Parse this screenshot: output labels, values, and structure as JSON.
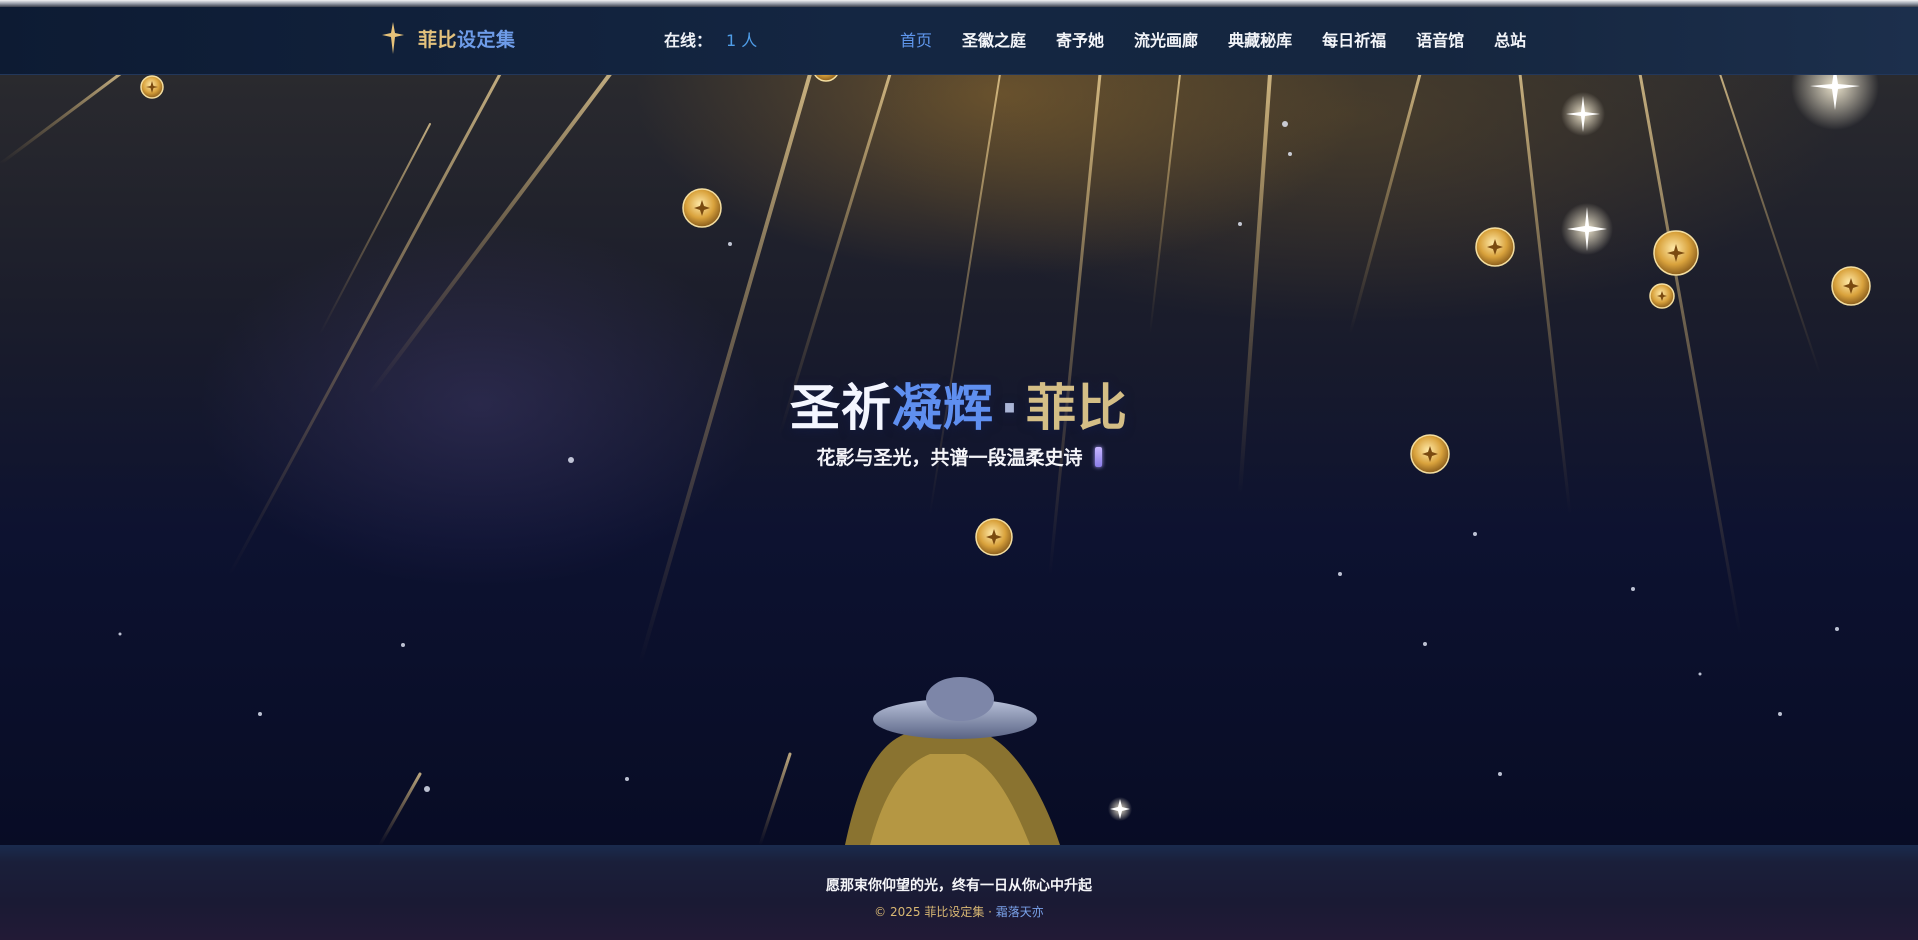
{
  "header": {
    "logo_icon": "sparkle-icon",
    "brand_part1": "菲比",
    "brand_part2": "设定集",
    "online_label": "在线：",
    "online_count": "1 人",
    "nav": [
      {
        "label": "首页",
        "active": true
      },
      {
        "label": "圣徽之庭"
      },
      {
        "label": "寄予她"
      },
      {
        "label": "流光画廊"
      },
      {
        "label": "典藏秘库"
      },
      {
        "label": "每日祈福"
      },
      {
        "label": "语音馆"
      },
      {
        "label": "总站"
      }
    ]
  },
  "hero": {
    "title_part1": "圣祈",
    "title_part2": "凝辉",
    "title_sep": "·",
    "title_part3": "菲比",
    "subtitle": "花影与圣光，共谱一段温柔史诗"
  },
  "footer": {
    "line1": "愿那束你仰望的光，终有一日从你心中升起",
    "copyright": "© 2025 菲比设定集 · ",
    "author": "霜落天亦"
  },
  "colors": {
    "accent_blue": "#5f96ec",
    "accent_gold": "#d4be86",
    "background": "#070b1f"
  }
}
